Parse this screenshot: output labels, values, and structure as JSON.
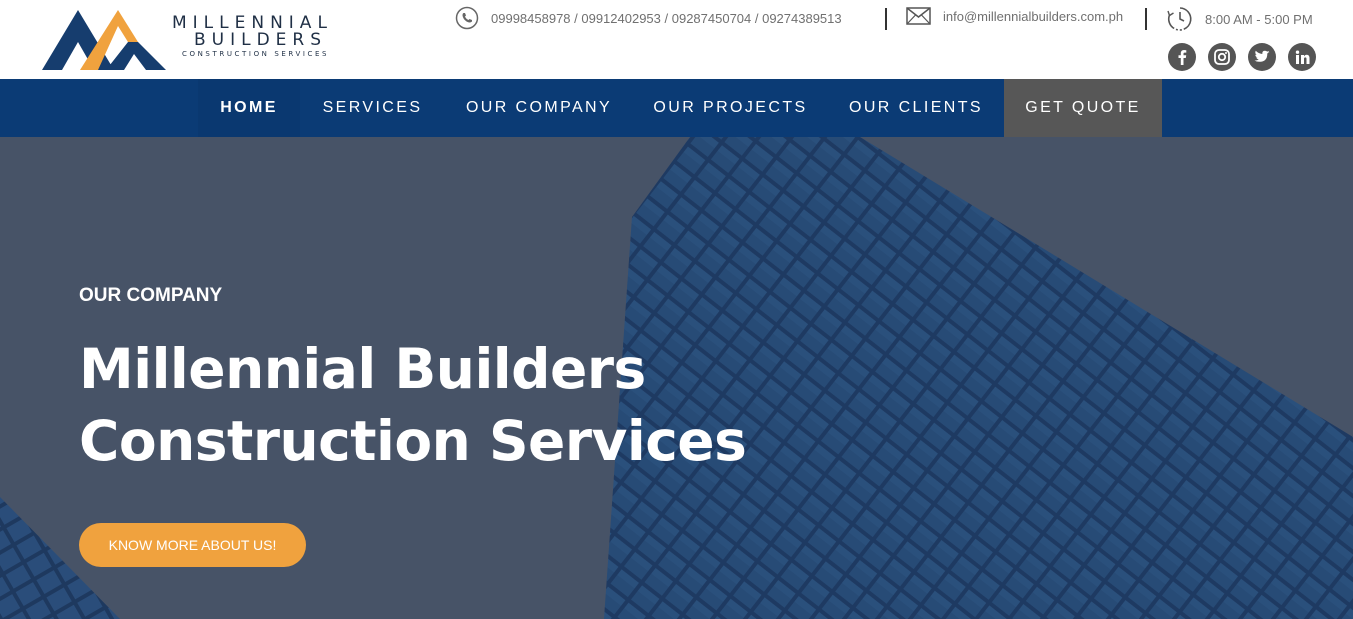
{
  "brand": {
    "name_line1": "MILLENNIAL",
    "name_line2": "BUILDERS",
    "tagline": "CONSTRUCTION SERVICES",
    "colors": {
      "navy": "#163d6e",
      "orange": "#f0a23e"
    }
  },
  "contact": {
    "phones": "09998458978 / 09912402953 / 09287450704 / 09274389513",
    "email": "info@millennialbuilders.com.ph",
    "hours": "8:00 AM - 5:00 PM",
    "icons": [
      "phone-icon",
      "mail-icon",
      "clock-icon"
    ]
  },
  "social": [
    {
      "name": "facebook",
      "icon": "facebook-icon"
    },
    {
      "name": "instagram",
      "icon": "instagram-icon"
    },
    {
      "name": "twitter",
      "icon": "twitter-icon"
    },
    {
      "name": "linkedin",
      "icon": "linkedin-icon"
    }
  ],
  "nav": {
    "items": [
      {
        "label": "HOME",
        "active": true
      },
      {
        "label": "SERVICES"
      },
      {
        "label": "OUR COMPANY"
      },
      {
        "label": "OUR PROJECTS"
      },
      {
        "label": "OUR CLIENTS"
      },
      {
        "label": "GET QUOTE",
        "highlight": true
      }
    ],
    "colors": {
      "background": "#0b3b75",
      "highlight": "#575757"
    }
  },
  "hero": {
    "eyebrow": "OUR COMPANY",
    "title_line1": "Millennial Builders",
    "title_line2": "Construction Services",
    "cta_label": "KNOW MORE ABOUT US!",
    "colors": {
      "cta": "#f0a23e",
      "overlay": "#4a5669"
    }
  }
}
